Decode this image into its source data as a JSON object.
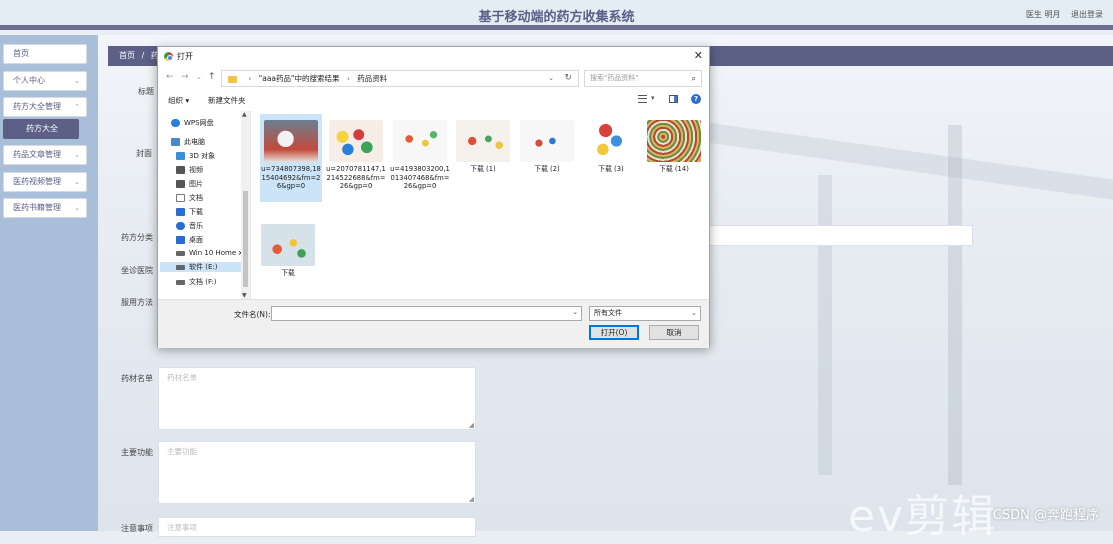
{
  "app": {
    "title": "基于移动端的药方收集系统",
    "user_role": "医生 明月",
    "logout": "退出登录"
  },
  "sidebar": {
    "items": [
      {
        "label": "首页"
      },
      {
        "label": "个人中心"
      },
      {
        "label": "药方大全管理"
      },
      {
        "label": "药方大全"
      },
      {
        "label": "药品文章管理"
      },
      {
        "label": "医药视频管理"
      },
      {
        "label": "医药书籍管理"
      }
    ]
  },
  "main": {
    "breadcrumb": [
      "首页",
      "/",
      "药"
    ],
    "labels": {
      "title": "标题",
      "cover": "封面",
      "category": "药方分类",
      "hospital": "坐诊医院",
      "usage": "服用方法",
      "ingredients": "药材名单",
      "functions": "主要功能",
      "notes": "注意事项"
    },
    "placeholders": {
      "ingredients": "药材名单",
      "functions": "主要功能",
      "notes": "注意事项"
    },
    "watermark_brand": "ev剪辑",
    "watermark_csdn": "CSDN @奔跑程序"
  },
  "dialog": {
    "title": "打开",
    "close": "✕",
    "address": {
      "path": [
        "\"aaa药品\"中的搜索结果",
        "药品资料"
      ],
      "separator": "›"
    },
    "search_placeholder": "搜索\"药品资料\"",
    "toolbar": {
      "organize": "组织 ▾",
      "new_folder": "新建文件夹"
    },
    "nav_pane": [
      {
        "label": "WPS网盘",
        "icon": "cloud-icon",
        "color": "#2b7de0"
      },
      {
        "label": "此电脑",
        "icon": "computer-icon",
        "color": "#4a87c9"
      },
      {
        "label": "3D 对象",
        "icon": "cube-icon",
        "color": "#3a8fd6"
      },
      {
        "label": "视频",
        "icon": "video-icon",
        "color": "#555555"
      },
      {
        "label": "图片",
        "icon": "picture-icon",
        "color": "#555555"
      },
      {
        "label": "文档",
        "icon": "document-icon",
        "color": "#777777"
      },
      {
        "label": "下载",
        "icon": "download-icon",
        "color": "#2a6dd1"
      },
      {
        "label": "音乐",
        "icon": "music-icon",
        "color": "#2a6dd1"
      },
      {
        "label": "桌面",
        "icon": "desktop-icon",
        "color": "#2a6dd1"
      },
      {
        "label": "Win 10 Home x",
        "icon": "drive-icon",
        "color": "#666666"
      },
      {
        "label": "软件 (E:)",
        "icon": "drive-icon",
        "color": "#666666"
      },
      {
        "label": "文档 (F:)",
        "icon": "drive-icon",
        "color": "#666666"
      }
    ],
    "files": [
      {
        "name": "u=734807398,1815404692&fm=26&gp=0",
        "thumb": "t1"
      },
      {
        "name": "u=2070781147,1214522688&fm=26&gp=0",
        "thumb": "t2"
      },
      {
        "name": "u=4193803200,1013407468&fm=26&gp=0",
        "thumb": "t3"
      },
      {
        "name": "下载 (1)",
        "thumb": "t4"
      },
      {
        "name": "下载 (2)",
        "thumb": "t5"
      },
      {
        "name": "下载 (3)",
        "thumb": "t6"
      },
      {
        "name": "下载 (14)",
        "thumb": "t7"
      },
      {
        "name": "下载",
        "thumb": "t8"
      }
    ],
    "filename_label": "文件名(N):",
    "filename_value": "",
    "file_type": "所有文件",
    "open_button": "打开(O)",
    "cancel_button": "取消"
  },
  "colors": {
    "brand": "#5c5f86",
    "sidebar_bg": "#a9bed8",
    "selection": "#cce4f7",
    "help": "#2a6dd1"
  }
}
